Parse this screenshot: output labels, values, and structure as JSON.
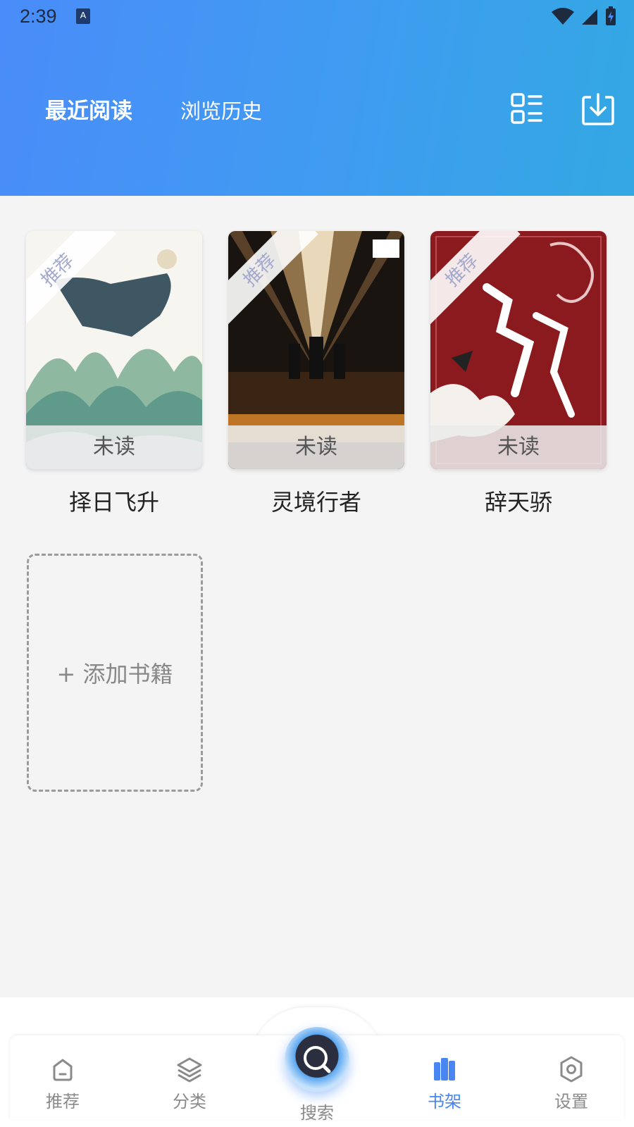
{
  "status_bar": {
    "time": "2:39",
    "a_icon": "A",
    "icons": [
      "wifi-icon",
      "signal-icon",
      "battery-charging-icon"
    ]
  },
  "header": {
    "tabs": [
      {
        "label": "最近阅读",
        "active": true
      },
      {
        "label": "浏览历史",
        "active": false
      }
    ],
    "right_icons": [
      "list-view-icon",
      "download-icon"
    ],
    "gradient": [
      "#4a8cf9",
      "#33a8e3"
    ]
  },
  "shelf": {
    "books": [
      {
        "title": "择日飞升",
        "status": "未读",
        "ribbon": "推荐"
      },
      {
        "title": "灵境行者",
        "status": "未读",
        "ribbon": "推荐"
      },
      {
        "title": "辞天骄",
        "status": "未读",
        "ribbon": "推荐"
      }
    ],
    "add_label": "+ 添加书籍"
  },
  "bottom_nav": {
    "items": [
      {
        "label": "推荐",
        "icon": "home-icon",
        "active": false
      },
      {
        "label": "分类",
        "icon": "layers-icon",
        "active": false
      },
      {
        "label": "搜索",
        "icon": "search-icon",
        "active": false
      },
      {
        "label": "书架",
        "icon": "bookshelf-icon",
        "active": true
      },
      {
        "label": "设置",
        "icon": "settings-icon",
        "active": false
      }
    ],
    "active_color": "#4a86f2"
  }
}
